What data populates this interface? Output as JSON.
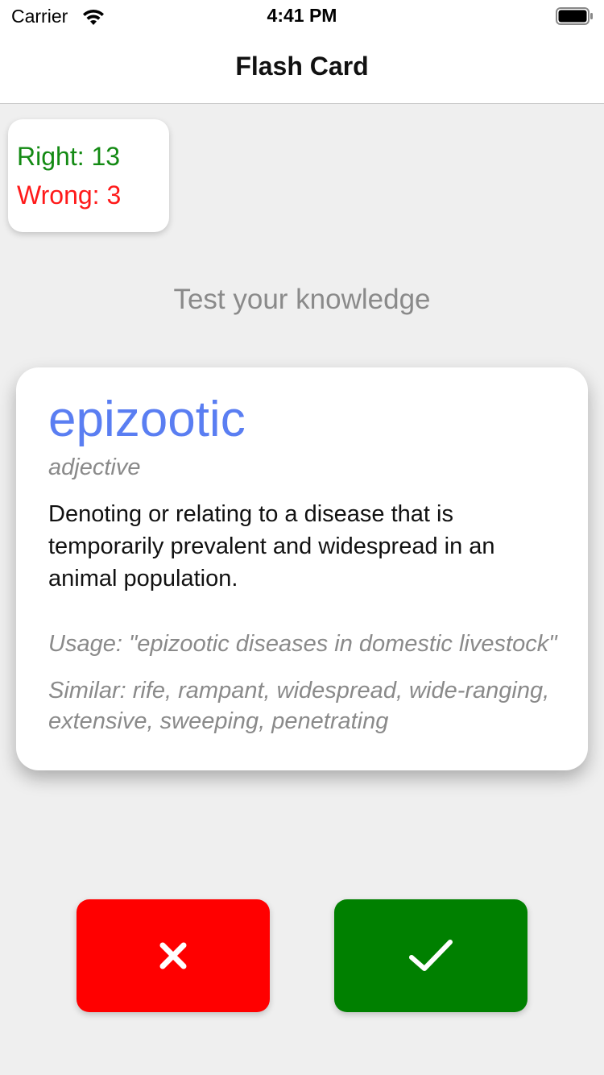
{
  "status_bar": {
    "carrier": "Carrier",
    "time": "4:41 PM",
    "wifi_icon": "wifi-icon",
    "battery_icon": "battery-icon"
  },
  "nav": {
    "title": "Flash Card"
  },
  "score": {
    "right_label": "Right: 13",
    "wrong_label": "Wrong: 3",
    "right_color": "#138a13",
    "wrong_color": "#ff1a1a"
  },
  "prompt": "Test your knowledge",
  "card": {
    "word": "epizootic",
    "part_of_speech": "adjective",
    "definition": "Denoting or relating to a disease that is temporarily prevalent and widespread in an animal population.",
    "usage": "Usage: \"epizootic diseases in domestic livestock\"",
    "similar": "Similar: rife, rampant, widespread, wide-ranging, extensive, sweeping, penetrating",
    "word_color": "#5a7ef2"
  },
  "actions": {
    "wrong_button": {
      "icon": "close-icon",
      "color": "#ff0000"
    },
    "right_button": {
      "icon": "checkmark-icon",
      "color": "#008000"
    }
  }
}
